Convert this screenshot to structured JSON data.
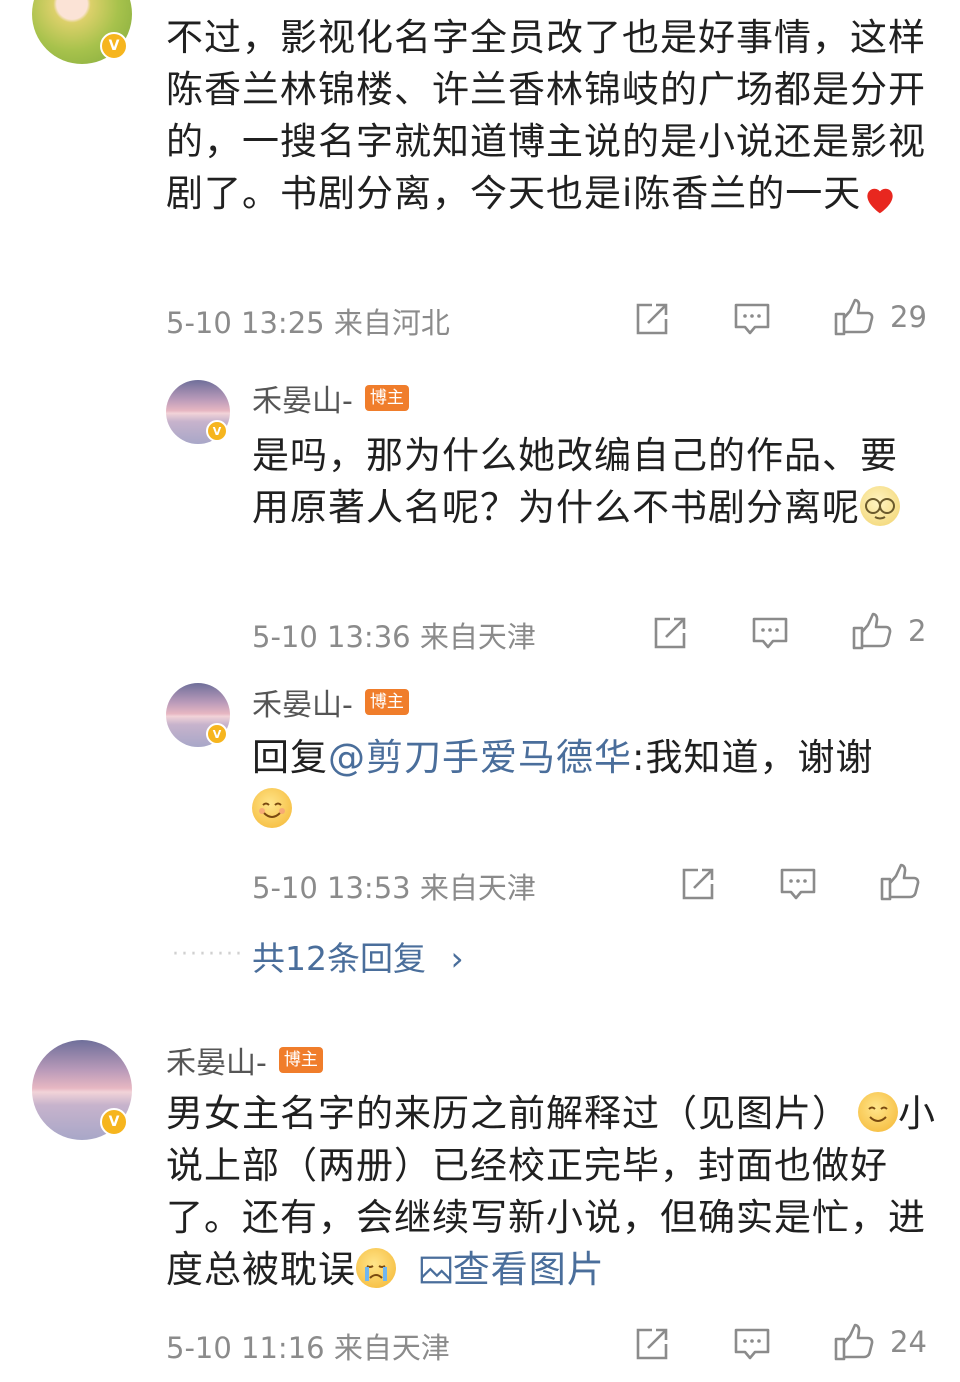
{
  "comment1": {
    "text_part1": "不过，影视化名字全员改了也是好事情，这样陈香兰林锦楼、许兰香林锦岐的广场都是分开的，一搜名字就知道博主说的是小说还是影视剧了。书剧分离，今天也是i陈香兰的一天",
    "meta": "5-10 13:25 来自河北",
    "likes": "29",
    "heart_icon": "heart-emoji"
  },
  "reply1": {
    "username": "禾晏山-",
    "badge": "博主",
    "text": "是吗，那为什么她改编自己的作品、要用原著人名呢？为什么不书剧分离呢",
    "meta": "5-10 13:36 来自天津",
    "likes": "2"
  },
  "reply2": {
    "username": "禾晏山-",
    "badge": "博主",
    "prefix": "回复",
    "mention": "@剪刀手爱马德华",
    "text": ":我知道，谢谢",
    "meta": "5-10 13:53 来自天津"
  },
  "more_replies": {
    "dots": "········",
    "label": "共12条回复",
    "chevron": "›"
  },
  "comment2": {
    "username": "禾晏山-",
    "badge": "博主",
    "text_part1": "男女主名字的来历之前解释过（见图片）",
    "text_part2": "小说上部（两册）已经校正完毕，封面也做好了。还有，会继续写新小说，但确实是忙，进度总被耽误",
    "view_image": "查看图片",
    "meta": "5-10 11:16 来自天津",
    "likes": "24"
  },
  "badge_letter": "V",
  "colors": {
    "accent_link": "#4a6e9b",
    "boss_tag": "#f07d2b",
    "verified": "#f6b51e"
  }
}
